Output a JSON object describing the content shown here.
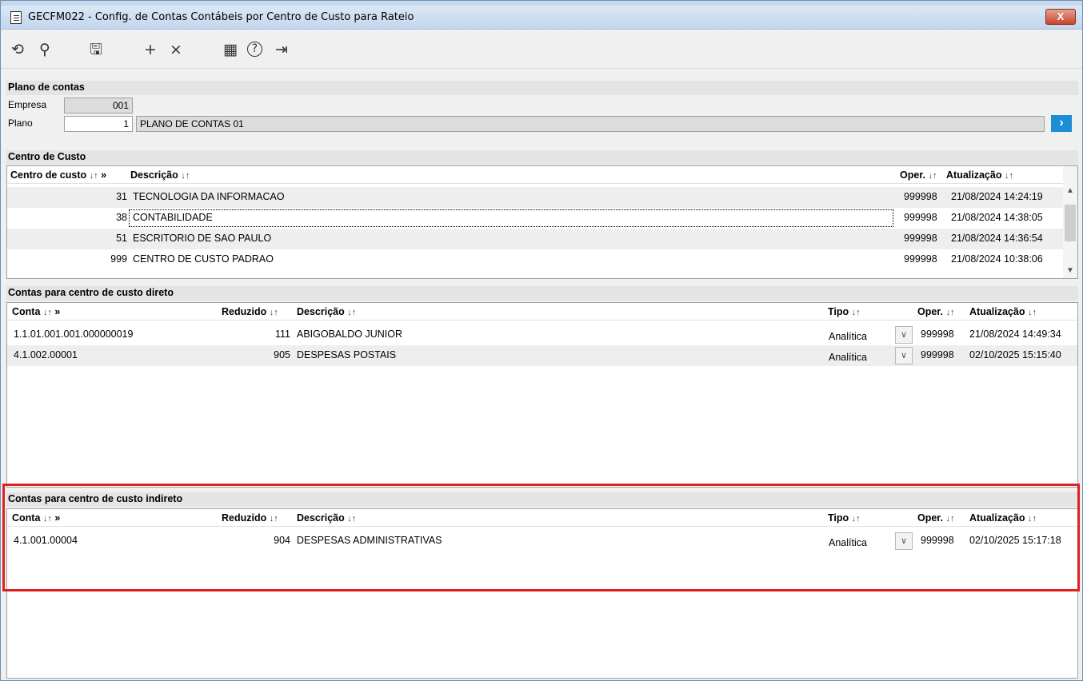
{
  "window": {
    "title": "GECFM022 - Config. de Contas Contábeis por Centro de Custo para Rateio",
    "close_label": "X"
  },
  "toolbar": {
    "icons": [
      "undo-icon",
      "search-icon",
      "save-icon",
      "add-icon",
      "delete-icon",
      "calendar-icon",
      "help-icon",
      "exit-icon"
    ],
    "glyphs": {
      "undo": "⟲",
      "search": "⚲",
      "save": "🖫",
      "add": "+",
      "delete": "×",
      "calendar": "▦",
      "help": "?",
      "exit": "⇥"
    }
  },
  "plano": {
    "section_title": "Plano de contas",
    "empresa_label": "Empresa",
    "empresa_value": "001",
    "plano_label": "Plano",
    "plano_value": "1",
    "plano_desc": "PLANO DE CONTAS 01",
    "go_label": "›"
  },
  "centro": {
    "section_title": "Centro de Custo",
    "headers": {
      "centro": "Centro de custo",
      "descricao": "Descrição",
      "oper": "Oper.",
      "atualizacao": "Atualização"
    },
    "sort_glyph": "↓↑",
    "more_glyph": "»",
    "rows": [
      {
        "codigo": "31",
        "descricao": "TECNOLOGIA DA INFORMACAO",
        "oper": "999998",
        "atualizacao": "21/08/2024 14:24:19"
      },
      {
        "codigo": "38",
        "descricao": "CONTABILIDADE",
        "oper": "999998",
        "atualizacao": "21/08/2024 14:38:05"
      },
      {
        "codigo": "51",
        "descricao": "ESCRITORIO DE SAO PAULO",
        "oper": "999998",
        "atualizacao": "21/08/2024 14:36:54"
      },
      {
        "codigo": "999",
        "descricao": "CENTRO DE CUSTO PADRAO",
        "oper": "999998",
        "atualizacao": "21/08/2024 10:38:06"
      }
    ]
  },
  "direto": {
    "section_title": "Contas para centro de custo direto",
    "headers": {
      "conta": "Conta",
      "reduzido": "Reduzido",
      "descricao": "Descrição",
      "tipo": "Tipo",
      "oper": "Oper.",
      "atualizacao": "Atualização"
    },
    "rows": [
      {
        "conta": "1.1.01.001.001.000000019",
        "reduzido": "111",
        "descricao": "ABIGOBALDO JUNIOR",
        "tipo": "Analítica",
        "oper": "999998",
        "atualizacao": "21/08/2024 14:49:34"
      },
      {
        "conta": "4.1.002.00001",
        "reduzido": "905",
        "descricao": "DESPESAS POSTAIS",
        "tipo": "Analítica",
        "oper": "999998",
        "atualizacao": "02/10/2025 15:15:40"
      }
    ]
  },
  "indireto": {
    "section_title": "Contas para centro de custo indireto",
    "headers": {
      "conta": "Conta",
      "reduzido": "Reduzido",
      "descricao": "Descrição",
      "tipo": "Tipo",
      "oper": "Oper.",
      "atualizacao": "Atualização"
    },
    "rows": [
      {
        "conta": "4.1.001.00004",
        "reduzido": "904",
        "descricao": "DESPESAS ADMINISTRATIVAS",
        "tipo": "Analítica",
        "oper": "999998",
        "atualizacao": "02/10/2025 15:17:18"
      }
    ]
  },
  "colors": {
    "accent": "#1c8ed6",
    "highlight": "#e02020"
  }
}
